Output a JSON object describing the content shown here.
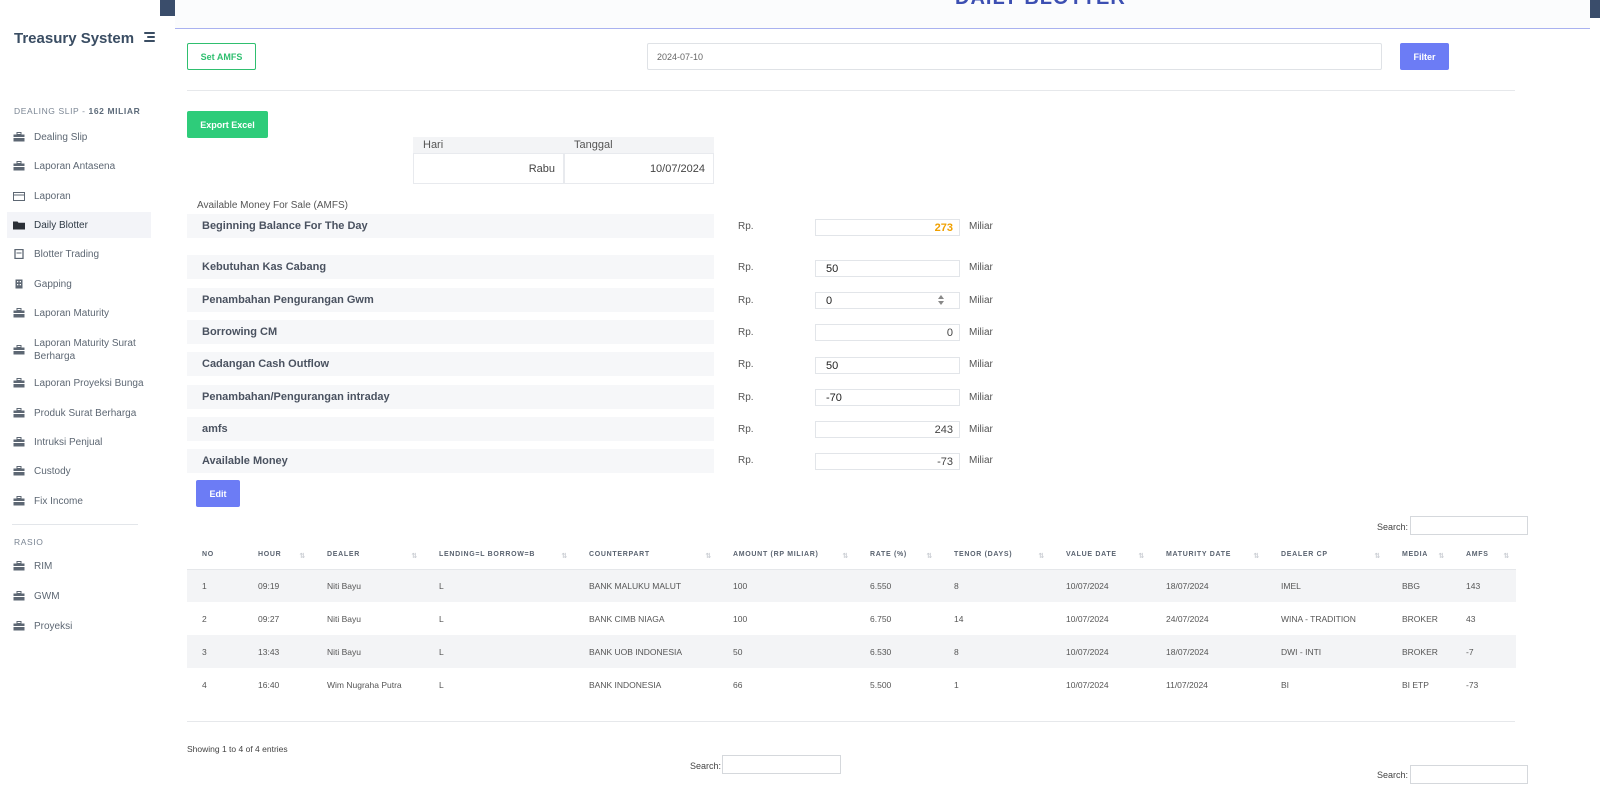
{
  "app": {
    "title": "Treasury System",
    "page_title": "DAILY BLOTTER"
  },
  "sidebar": {
    "section1_heading_prefix": "DEALING SLIP - ",
    "section1_heading_bold": "162 MILIAR",
    "items": [
      {
        "label": "Dealing Slip",
        "icon": "briefcase-icon"
      },
      {
        "label": "Laporan Antasena",
        "icon": "briefcase-icon"
      },
      {
        "label": "Laporan",
        "icon": "calendar-icon"
      },
      {
        "label": "Daily Blotter",
        "icon": "folder-icon",
        "active": true
      },
      {
        "label": "Blotter Trading",
        "icon": "book-icon"
      },
      {
        "label": "Gapping",
        "icon": "building-icon"
      },
      {
        "label": "Laporan Maturity",
        "icon": "briefcase-icon"
      },
      {
        "label": "Laporan Maturity Surat Berharga",
        "icon": "briefcase-icon"
      },
      {
        "label": "Laporan Proyeksi Bunga",
        "icon": "briefcase-icon"
      },
      {
        "label": "Produk Surat Berharga",
        "icon": "briefcase-icon"
      },
      {
        "label": "Intruksi Penjual",
        "icon": "briefcase-icon"
      },
      {
        "label": "Custody",
        "icon": "briefcase-icon"
      },
      {
        "label": "Fix Income",
        "icon": "briefcase-icon"
      }
    ],
    "section2_heading": "RASIO",
    "items2": [
      {
        "label": "RIM",
        "icon": "briefcase-icon"
      },
      {
        "label": "GWM",
        "icon": "briefcase-icon"
      },
      {
        "label": "Proyeksi",
        "icon": "briefcase-icon"
      }
    ]
  },
  "toolbar": {
    "set_amfs": "Set AMFS",
    "date_value": "2024-07-10",
    "filter": "Filter",
    "export_excel": "Export Excel"
  },
  "day_table": {
    "hari_label": "Hari",
    "tanggal_label": "Tanggal",
    "hari_value": "Rabu",
    "tanggal_value": "10/07/2024"
  },
  "amfs": {
    "title": "Available Money For Sale (AMFS)",
    "currency": "Rp.",
    "unit": "Miliar",
    "rows": [
      {
        "label": "Beginning Balance For The Day",
        "value": "273"
      },
      {
        "label": "Kebutuhan Kas Cabang",
        "value": "50"
      },
      {
        "label": "Penambahan Pengurangan Gwm",
        "value": "0"
      },
      {
        "label": "Borrowing CM",
        "value": "0"
      },
      {
        "label": "Cadangan Cash Outflow",
        "value": "50"
      },
      {
        "label": "Penambahan/Pengurangan intraday",
        "value": "-70"
      },
      {
        "label": "amfs",
        "value": "243"
      },
      {
        "label": "Available Money",
        "value": "-73"
      }
    ],
    "edit": "Edit"
  },
  "table": {
    "search_label": "Search:",
    "headers": [
      "NO",
      "HOUR",
      "DEALER",
      "LENDING=L BORROW=B",
      "COUNTERPART",
      "AMOUNT (RP MILIAR)",
      "RATE (%)",
      "TENOR (DAYS)",
      "VALUE DATE",
      "MATURITY DATE",
      "DEALER CP",
      "MEDIA",
      "AMFS"
    ],
    "rows": [
      [
        "1",
        "09:19",
        "Niti Bayu",
        "L",
        "BANK MALUKU MALUT",
        "100",
        "6.550",
        "8",
        "10/07/2024",
        "18/07/2024",
        "IMEL",
        "BBG",
        "143"
      ],
      [
        "2",
        "09:27",
        "Niti Bayu",
        "L",
        "BANK CIMB NIAGA",
        "100",
        "6.750",
        "14",
        "10/07/2024",
        "24/07/2024",
        "WINA - TRADITION",
        "BROKER",
        "43"
      ],
      [
        "3",
        "13:43",
        "Niti Bayu",
        "L",
        "BANK UOB INDONESIA",
        "50",
        "6.530",
        "8",
        "10/07/2024",
        "18/07/2024",
        "DWI - INTI",
        "BROKER",
        "-7"
      ],
      [
        "4",
        "16:40",
        "Wim Nugraha Putra",
        "L",
        "BANK INDONESIA",
        "66",
        "5.500",
        "1",
        "10/07/2024",
        "11/07/2024",
        "BI",
        "BI ETP",
        "-73"
      ]
    ],
    "info": "Showing 1 to 4 of 4 entries"
  },
  "colors": {
    "accent_blue": "#6c7cf5",
    "accent_green": "#2ecc7a",
    "highlight_orange": "#f0a000"
  }
}
